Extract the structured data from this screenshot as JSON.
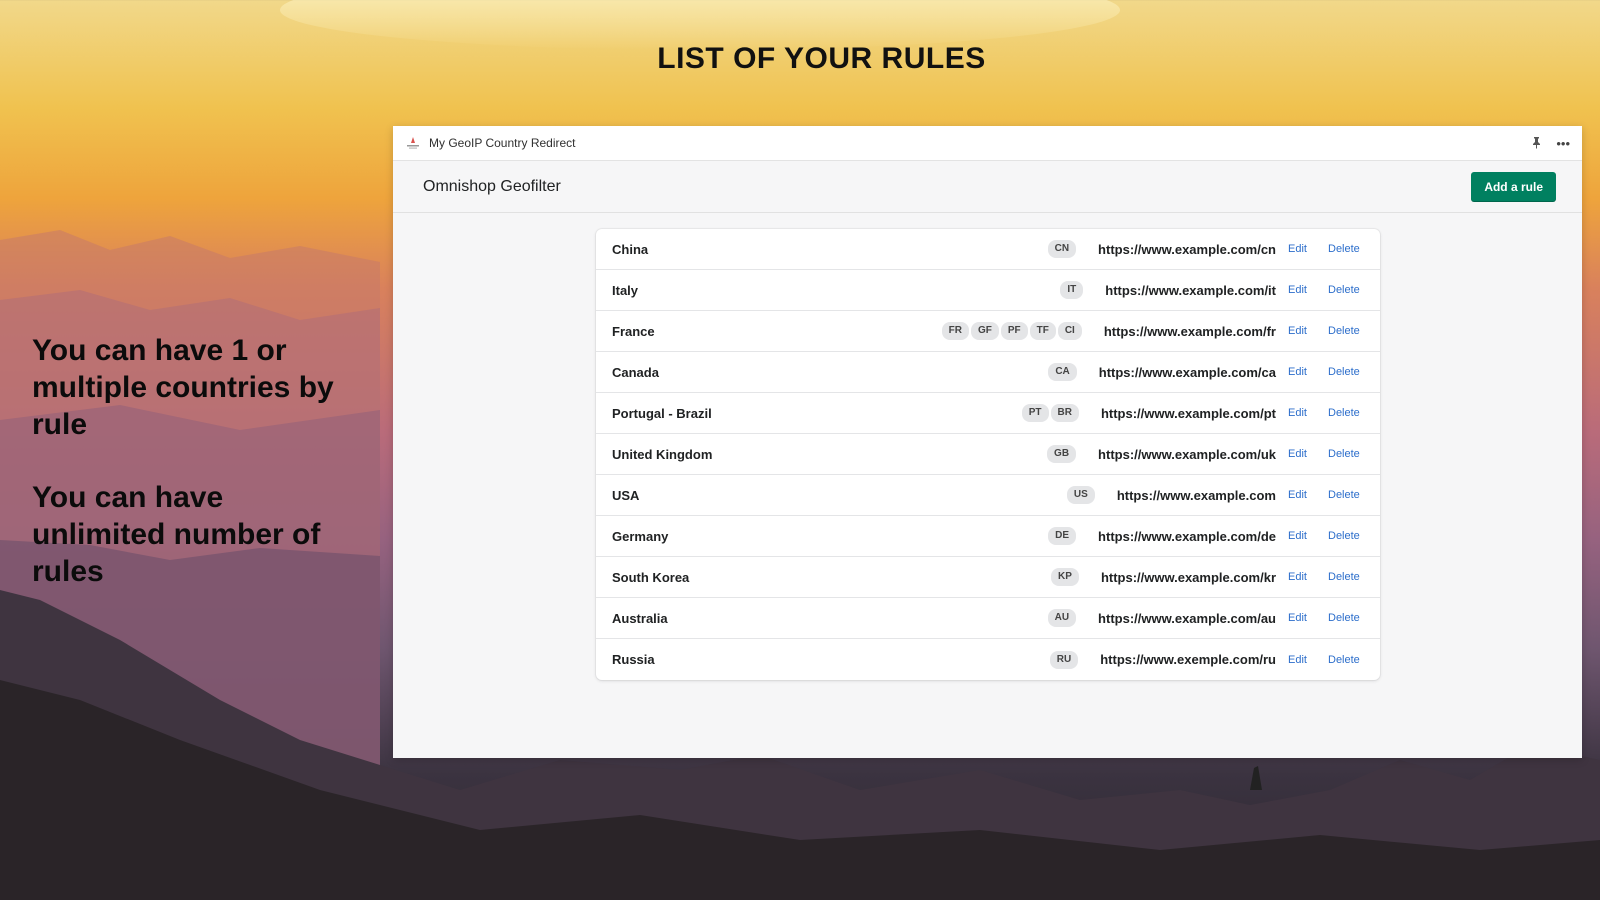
{
  "slide": {
    "title": "LIST OF YOUR RULES",
    "promo_1": "You can have 1 or multiple countries by rule",
    "promo_2": "You can have unlimited number of rules"
  },
  "app": {
    "name": "My GeoIP Country Redirect",
    "pin_icon": "pin-icon",
    "more_icon": "more-icon",
    "page_title": "Omnishop Geofilter",
    "add_rule_label": "Add a rule",
    "accent_color": "#008060"
  },
  "rules": [
    {
      "name": "China",
      "codes": [
        "CN"
      ],
      "url": "https://www.example.com/cn",
      "edit": "Edit",
      "delete": "Delete"
    },
    {
      "name": "Italy",
      "codes": [
        "IT"
      ],
      "url": "https://www.example.com/it",
      "edit": "Edit",
      "delete": "Delete"
    },
    {
      "name": "France",
      "codes": [
        "FR",
        "GF",
        "PF",
        "TF",
        "CI"
      ],
      "url": "https://www.example.com/fr",
      "edit": "Edit",
      "delete": "Delete"
    },
    {
      "name": "Canada",
      "codes": [
        "CA"
      ],
      "url": "https://www.example.com/ca",
      "edit": "Edit",
      "delete": "Delete"
    },
    {
      "name": "Portugal - Brazil",
      "codes": [
        "PT",
        "BR"
      ],
      "url": "https://www.example.com/pt",
      "edit": "Edit",
      "delete": "Delete"
    },
    {
      "name": "United Kingdom",
      "codes": [
        "GB"
      ],
      "url": "https://www.example.com/uk",
      "edit": "Edit",
      "delete": "Delete"
    },
    {
      "name": "USA",
      "codes": [
        "US"
      ],
      "url": "https://www.example.com",
      "edit": "Edit",
      "delete": "Delete"
    },
    {
      "name": "Germany",
      "codes": [
        "DE"
      ],
      "url": "https://www.example.com/de",
      "edit": "Edit",
      "delete": "Delete"
    },
    {
      "name": "South Korea",
      "codes": [
        "KP"
      ],
      "url": "https://www.example.com/kr",
      "edit": "Edit",
      "delete": "Delete"
    },
    {
      "name": "Australia",
      "codes": [
        "AU"
      ],
      "url": "https://www.example.com/au",
      "edit": "Edit",
      "delete": "Delete"
    },
    {
      "name": "Russia",
      "codes": [
        "RU"
      ],
      "url": "https://www.exemple.com/ru",
      "edit": "Edit",
      "delete": "Delete"
    }
  ]
}
